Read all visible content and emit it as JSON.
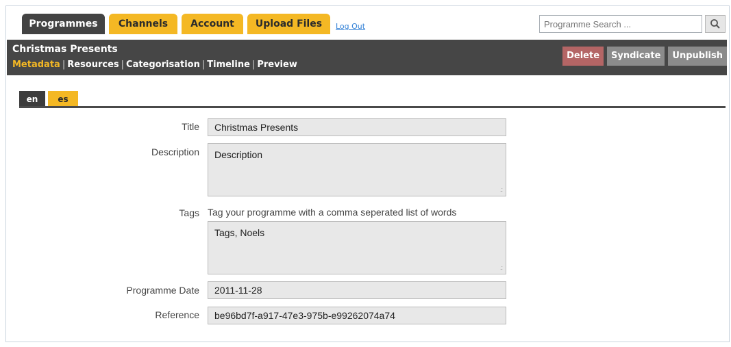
{
  "nav": {
    "tabs": [
      {
        "label": "Programmes",
        "active": true
      },
      {
        "label": "Channels",
        "active": false
      },
      {
        "label": "Account",
        "active": false
      },
      {
        "label": "Upload Files",
        "active": false
      }
    ],
    "logout_label": "Log Out",
    "search_placeholder": "Programme Search ..."
  },
  "header": {
    "title": "Christmas Presents",
    "subnav": [
      "Metadata",
      "Resources",
      "Categorisation",
      "Timeline",
      "Preview"
    ],
    "active_subnav": "Metadata",
    "actions": {
      "delete": "Delete",
      "syndicate": "Syndicate",
      "unpublish": "Unpublish"
    }
  },
  "languages": {
    "active": "en",
    "other": "es"
  },
  "form": {
    "title_label": "Title",
    "title_value": "Christmas Presents",
    "description_label": "Description",
    "description_value": "Description",
    "tags_label": "Tags",
    "tags_hint": "Tag your programme with a comma seperated list of words",
    "tags_value": "Tags, Noels",
    "date_label": "Programme Date",
    "date_value": "2011-11-28",
    "reference_label": "Reference",
    "reference_value": "be96bd7f-a917-47e3-975b-e99262074a74"
  },
  "colors": {
    "accent": "#f4b824",
    "dark": "#434343",
    "delete": "#b46565",
    "grey_button": "#8b8b8b",
    "link": "#2f7fd6"
  }
}
